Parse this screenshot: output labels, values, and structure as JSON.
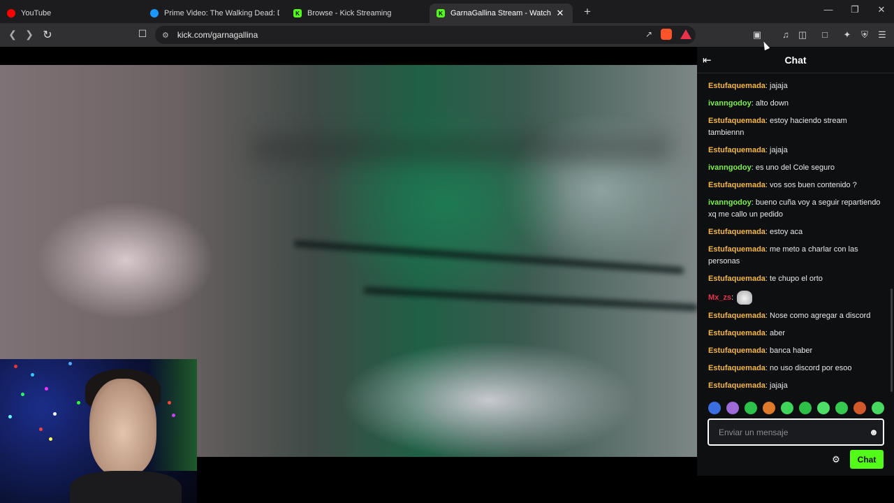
{
  "browser": {
    "tabs": [
      {
        "title": "YouTube",
        "favicon": "youtube-icon",
        "color": "#ff0000",
        "active": false
      },
      {
        "title": "Prime Video: The Walking Dead: Dea",
        "favicon": "prime-video-icon",
        "color": "#1a98ff",
        "active": false
      },
      {
        "title": "Browse - Kick Streaming",
        "favicon": "kick-icon",
        "color": "#53fc18",
        "active": false
      },
      {
        "title": "GarnaGallina Stream - Watch",
        "favicon": "kick-icon",
        "color": "#53fc18",
        "active": true
      }
    ],
    "url": "kick.com/garnagallina"
  },
  "chat": {
    "title": "Chat",
    "messages": [
      {
        "user": "Estufaquemada",
        "color": "#f5b748",
        "text": "jajaja"
      },
      {
        "user": "ivanngodoy",
        "color": "#7cf24c",
        "text": "alto down"
      },
      {
        "user": "Estufaquemada",
        "color": "#f5b748",
        "text": "estoy haciendo stream tambiennn"
      },
      {
        "user": "Estufaquemada",
        "color": "#f5b748",
        "text": "jajaja"
      },
      {
        "user": "ivanngodoy",
        "color": "#7cf24c",
        "text": "es uno del Cole seguro"
      },
      {
        "user": "Estufaquemada",
        "color": "#f5b748",
        "text": "vos sos buen contenido ?"
      },
      {
        "user": "ivanngodoy",
        "color": "#7cf24c",
        "text": "bueno cuña voy a seguir repartiendo xq me callo un pedido"
      },
      {
        "user": "Estufaquemada",
        "color": "#f5b748",
        "text": "estoy aca"
      },
      {
        "user": "Estufaquemada",
        "color": "#f5b748",
        "text": "me meto a charlar con las personas"
      },
      {
        "user": "Estufaquemada",
        "color": "#f5b748",
        "text": "te chupo el orto"
      },
      {
        "user": "Mx_zs",
        "color": "#e8344c",
        "text": "",
        "emote": "cat-emote"
      },
      {
        "user": "Estufaquemada",
        "color": "#f5b748",
        "text": "Nose como agregar a discord"
      },
      {
        "user": "Estufaquemada",
        "color": "#f5b748",
        "text": "aber"
      },
      {
        "user": "Estufaquemada",
        "color": "#f5b748",
        "text": "banca haber"
      },
      {
        "user": "Estufaquemada",
        "color": "#f5b748",
        "text": "no uso discord por esoo"
      },
      {
        "user": "Estufaquemada",
        "color": "#f5b748",
        "text": "jajaja"
      }
    ],
    "emotes": [
      "emote-1",
      "emote-2",
      "emote-3",
      "emote-4",
      "emote-5",
      "emote-6",
      "emote-7",
      "emote-8",
      "emote-9",
      "emote-10"
    ],
    "input_placeholder": "Enviar un mensaje",
    "send_label": "Chat"
  }
}
